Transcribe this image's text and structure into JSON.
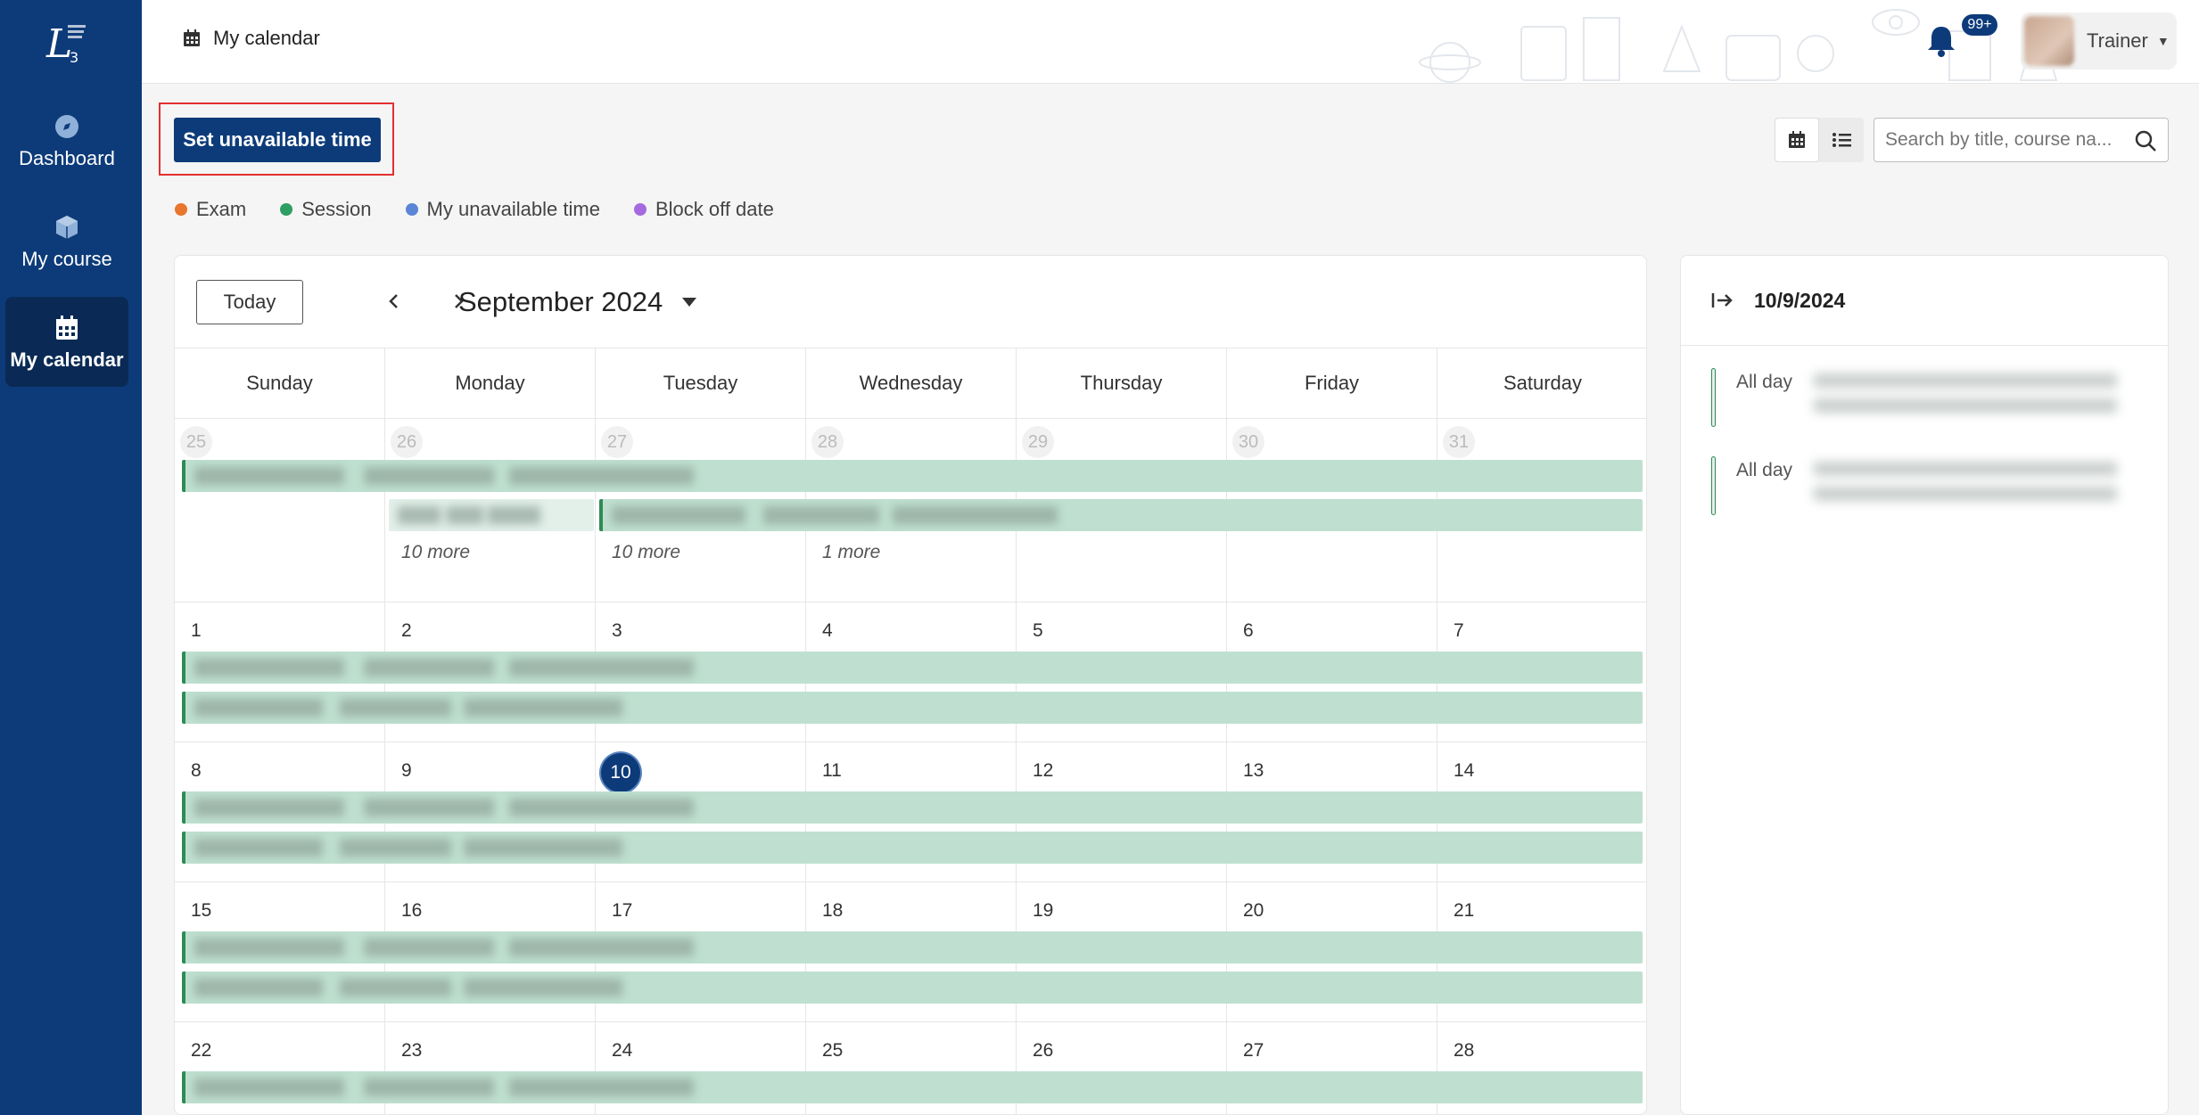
{
  "sidebar": {
    "items": [
      {
        "label": "Dashboard",
        "icon": "compass-icon"
      },
      {
        "label": "My course",
        "icon": "cube-icon"
      },
      {
        "label": "My calendar",
        "icon": "calendar-icon",
        "active": true
      }
    ]
  },
  "header": {
    "title": "My calendar",
    "notification_badge": "99+",
    "user_name": "Trainer"
  },
  "toolbar": {
    "set_unavailable_label": "Set unavailable time",
    "search_placeholder": "Search by title, course na..."
  },
  "legend": [
    {
      "label": "Exam",
      "color": "#e8762c"
    },
    {
      "label": "Session",
      "color": "#2e9e63"
    },
    {
      "label": "My unavailable time",
      "color": "#5b86d6"
    },
    {
      "label": "Block off date",
      "color": "#a56ae0"
    }
  ],
  "calendar": {
    "today_label": "Today",
    "month_title": "September 2024",
    "weekdays": [
      "Sunday",
      "Monday",
      "Tuesday",
      "Wednesday",
      "Thursday",
      "Friday",
      "Saturday"
    ],
    "weeks": [
      {
        "days": [
          "25",
          "26",
          "27",
          "28",
          "29",
          "30",
          "31"
        ],
        "other_month": true,
        "more": [
          "",
          "10 more",
          "10 more",
          "1 more",
          "",
          "",
          ""
        ]
      },
      {
        "days": [
          "1",
          "2",
          "3",
          "4",
          "5",
          "6",
          "7"
        ]
      },
      {
        "days": [
          "8",
          "9",
          "10",
          "11",
          "12",
          "13",
          "14"
        ],
        "today_index": 2
      },
      {
        "days": [
          "15",
          "16",
          "17",
          "18",
          "19",
          "20",
          "21"
        ]
      },
      {
        "days": [
          "22",
          "23",
          "24",
          "25",
          "26",
          "27",
          "28"
        ]
      }
    ]
  },
  "side_panel": {
    "date": "10/9/2024",
    "events": [
      {
        "label": "All day"
      },
      {
        "label": "All day"
      }
    ]
  },
  "colors": {
    "primary": "#0d3b7a",
    "event_bg": "#bfe0d0",
    "event_border": "#2e8b57",
    "highlight": "#e23030"
  }
}
